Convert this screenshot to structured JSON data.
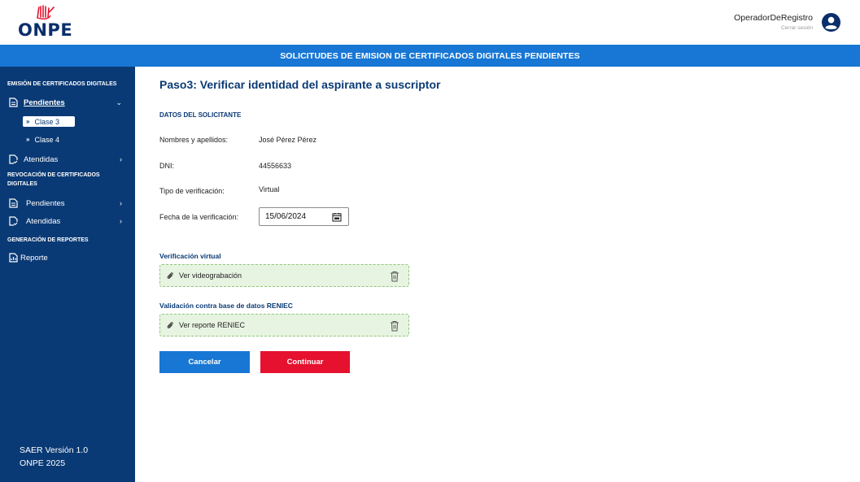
{
  "header": {
    "logo_text": "ONPE",
    "user_name": "OperadorDeRegistro",
    "logout_label": "Cerrar sesión"
  },
  "banner": {
    "title": "SOLICITUDES DE EMISION DE CERTIFICADOS DIGITALES PENDIENTES"
  },
  "sidebar": {
    "section1_title": "EMISIÓN DE CERTIFICADOS DIGITALES",
    "pendientes1_label": "Pendientes",
    "clase3_label": "Clase 3",
    "clase4_label": "Clase 4",
    "atendidas1_label": "Atendidas",
    "section2_title": "REVOCACIÓN DE CERTIFICADOS DIGITALES",
    "pendientes2_label": "Pendientes",
    "atendidas2_label": "Atendidas",
    "section3_title": "GENERACIÓN DE REPORTES",
    "reporte_label": "Reporte",
    "footer_version": "SAER Versión 1.0",
    "footer_org": "ONPE 2025"
  },
  "main": {
    "title": "Paso3: Verificar identidad del aspirante a suscriptor",
    "applicant_section": "DATOS DEL SOLICITANTE",
    "name_label": "Nombres y apellidos:",
    "name_value": "José Pérez Pérez",
    "dni_label": "DNI:",
    "dni_value": "44556633",
    "verif_type_label": "Tipo de verificación:",
    "verif_type_value": "Virtual",
    "verif_date_label": "Fecha de la verificación:",
    "verif_date_value": "15/06/2024",
    "virtual_heading": "Verificación virtual",
    "video_link": "Ver videograbación",
    "reniec_heading": "Validación contra base de datos RENIEC",
    "reniec_link": "Ver reporte RENIEC",
    "cancel_label": "Cancelar",
    "continue_label": "Continuar"
  },
  "colors": {
    "primary_blue": "#1877d4",
    "navy": "#0a3a75",
    "danger_red": "#e5112e",
    "attach_bg": "#e8f4e2"
  }
}
